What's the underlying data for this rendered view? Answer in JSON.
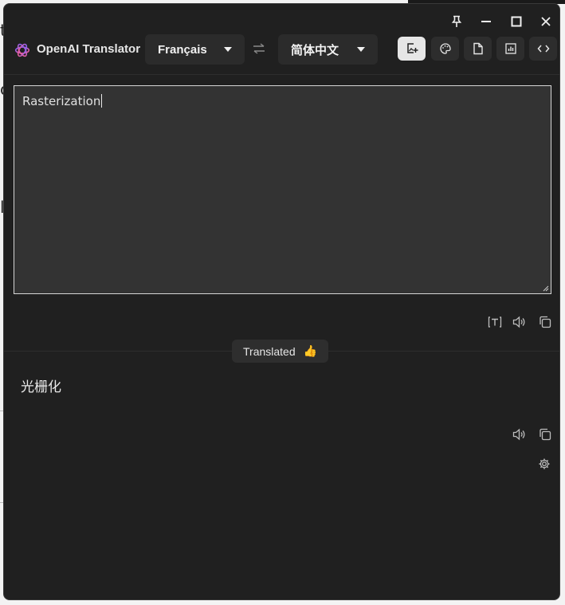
{
  "app": {
    "title": "OpenAI Translator"
  },
  "languages": {
    "source": "Français",
    "target": "简体中文"
  },
  "source": {
    "text": "Rasterization"
  },
  "status": {
    "label": "Translated",
    "emoji": "👍"
  },
  "result": {
    "text": "光栅化"
  },
  "colors": {
    "window_bg": "#202020",
    "panel_bg": "#2b2b2b",
    "input_bg": "#333333",
    "active_tool": "#e6e6e6"
  }
}
